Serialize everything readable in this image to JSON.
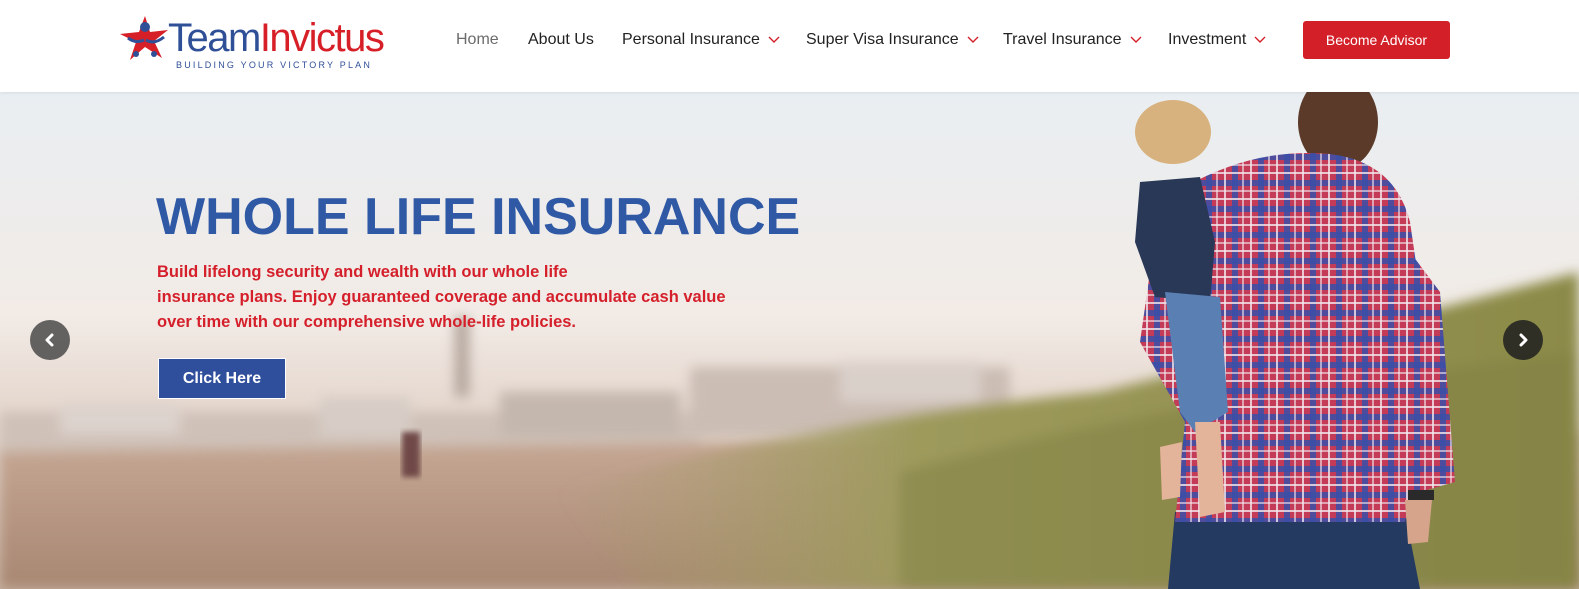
{
  "brand": {
    "name_part1": "Team",
    "name_part2": "Invictus",
    "tagline": "BUILDING YOUR VICTORY PLAN",
    "primary_color": "#2f4f97",
    "accent_color": "#d71f27"
  },
  "nav": {
    "items": [
      {
        "label": "Home",
        "active": true,
        "dropdown": false
      },
      {
        "label": "About Us",
        "active": false,
        "dropdown": false
      },
      {
        "label": "Personal Insurance",
        "active": false,
        "dropdown": true
      },
      {
        "label": "Super Visa Insurance",
        "active": false,
        "dropdown": true
      },
      {
        "label": "Travel Insurance",
        "active": false,
        "dropdown": true
      },
      {
        "label": "Investment",
        "active": false,
        "dropdown": true
      }
    ],
    "cta_label": "Become Advisor"
  },
  "hero": {
    "title": "WHOLE LIFE INSURANCE",
    "description_lines": [
      "Build lifelong security and wealth with our whole life",
      "insurance plans. Enjoy guaranteed coverage and accumulate cash value",
      "over time with our comprehensive whole-life policies."
    ],
    "button_label": "Click Here",
    "title_color": "#2f59a5",
    "text_color": "#d5202b",
    "button_color": "#2f4f9c",
    "background_image": "father-carrying-child-on-beach-photo"
  },
  "carousel": {
    "prev_icon": "chevron-left-icon",
    "next_icon": "chevron-right-icon"
  }
}
